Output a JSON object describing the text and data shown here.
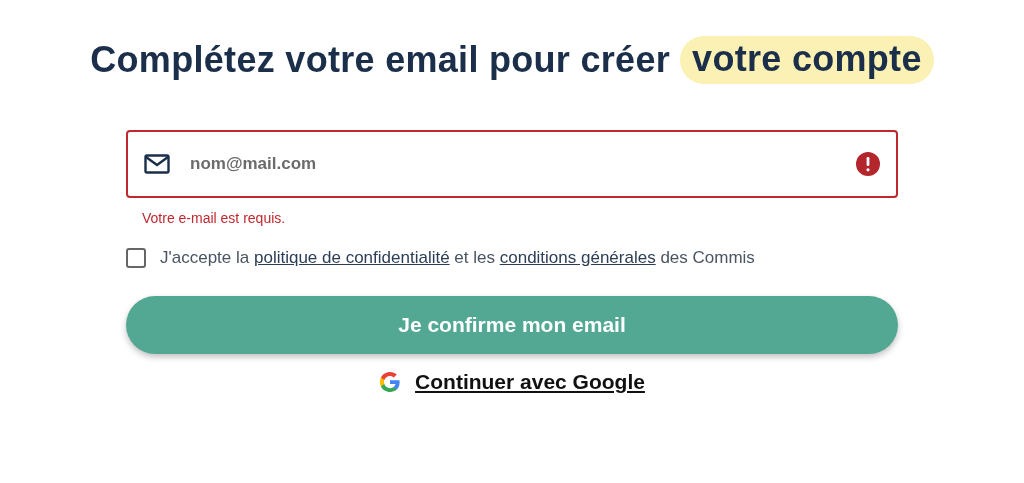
{
  "heading": {
    "text": "Complétez votre email pour créer",
    "highlight": "votre compte"
  },
  "email_field": {
    "placeholder": "nom@mail.com",
    "error": true,
    "error_message": "Votre e-mail est requis."
  },
  "consent": {
    "checked": false,
    "parts": [
      {
        "kind": "text",
        "text": "J'accepte la "
      },
      {
        "kind": "link",
        "text": "politique de confidentialité"
      },
      {
        "kind": "text",
        "text": " et les "
      },
      {
        "kind": "link",
        "text": "conditions générales"
      },
      {
        "kind": "text",
        "text": " des Commis"
      }
    ]
  },
  "submit_button": "Je confirme mon email",
  "google_link": "Continuer avec Google"
}
